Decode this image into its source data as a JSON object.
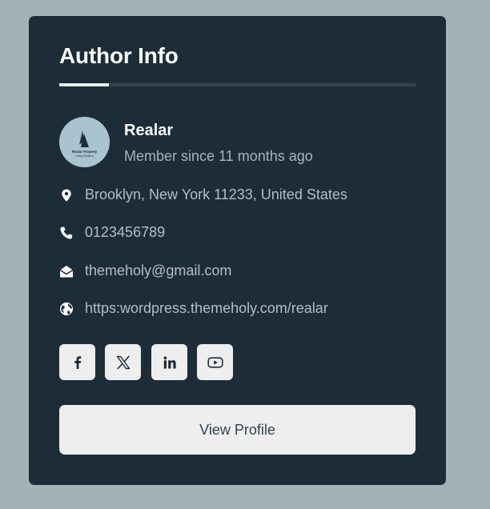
{
  "widget": {
    "title": "Author Info"
  },
  "author": {
    "name": "Realar",
    "member_since": "Member since 11 months ago",
    "avatar_logo_line1": "Realar Property",
    "avatar_logo_line2": "Living Solutions"
  },
  "contact": [
    {
      "icon": "location-pin-icon",
      "text": "Brooklyn, New York 11233, United States"
    },
    {
      "icon": "phone-icon",
      "text": "0123456789"
    },
    {
      "icon": "envelope-open-icon",
      "text": "themeholy@gmail.com"
    },
    {
      "icon": "globe-icon",
      "text": "https:wordpress.themeholy.com/realar"
    }
  ],
  "social": [
    {
      "icon": "facebook-icon",
      "label": "Facebook"
    },
    {
      "icon": "x-twitter-icon",
      "label": "X"
    },
    {
      "icon": "linkedin-icon",
      "label": "LinkedIn"
    },
    {
      "icon": "youtube-icon",
      "label": "YouTube"
    }
  ],
  "actions": {
    "view_profile_label": "View Profile"
  },
  "colors": {
    "page_background": "#a2b2b6",
    "card_background": "#1d2d38",
    "accent": "#e3f0ec",
    "button_background": "#eeeeee"
  }
}
